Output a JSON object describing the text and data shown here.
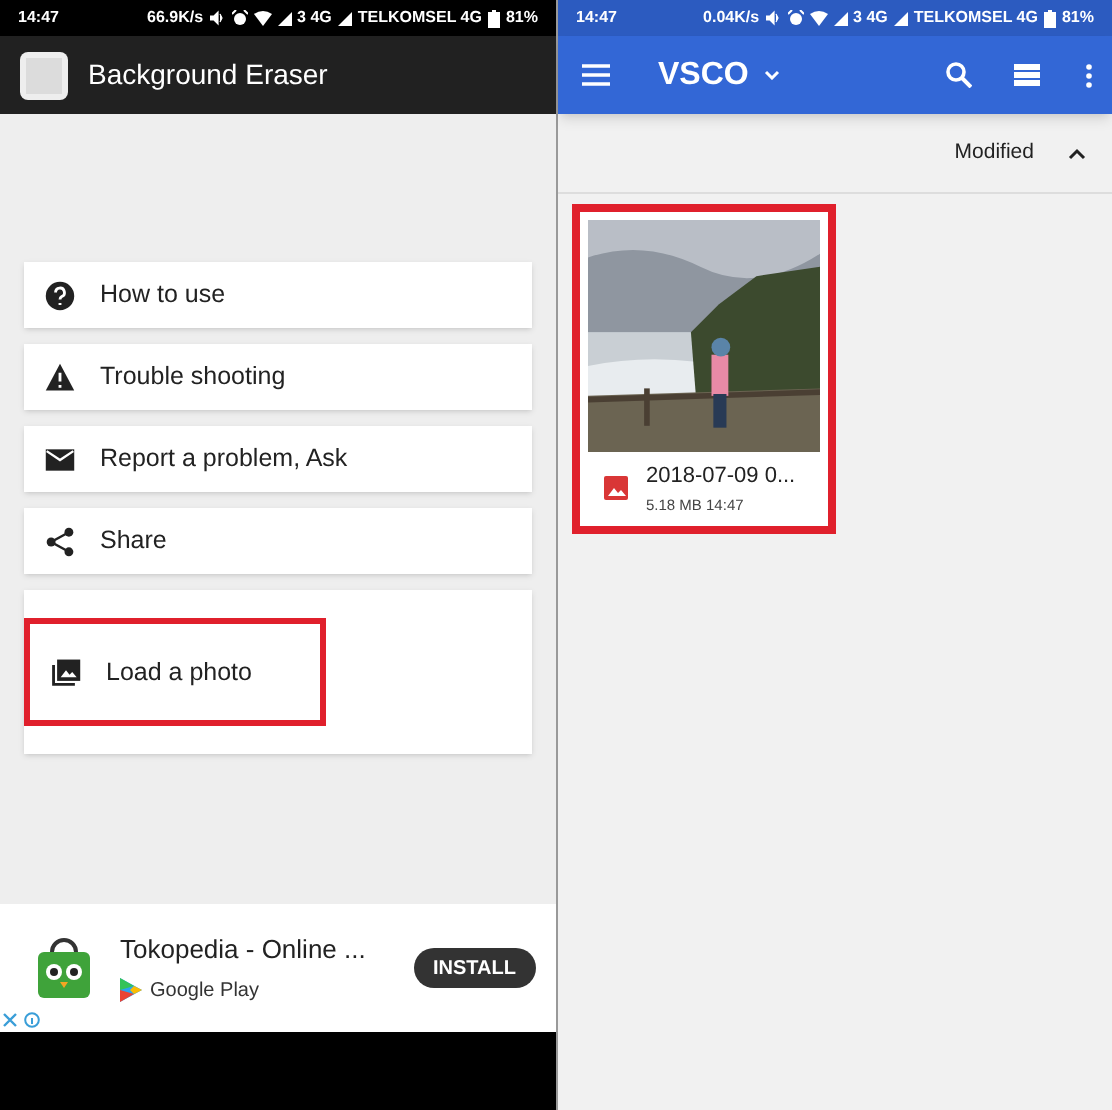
{
  "left_screen": {
    "status_bar": {
      "time": "14:47",
      "speed": "66.9K/s",
      "network_1": "3 4G",
      "carrier": "TELKOMSEL 4G",
      "battery": "81%"
    },
    "app_bar": {
      "title": "Background Eraser"
    },
    "menu": [
      {
        "kind": "help",
        "label": "How to use",
        "highlighted": false
      },
      {
        "kind": "warning",
        "label": "Trouble shooting",
        "highlighted": false
      },
      {
        "kind": "mail",
        "label": "Report a problem, Ask",
        "highlighted": false
      },
      {
        "kind": "share",
        "label": "Share",
        "highlighted": false
      },
      {
        "label": "Load a photo",
        "highlighted": true
      }
    ],
    "ad": {
      "title": "Tokopedia - Online ...",
      "store": "Google Play",
      "button": "INSTALL"
    }
  },
  "right_screen": {
    "status_bar": {
      "time": "14:47",
      "speed": "0.04K/s",
      "network_1": "3 4G",
      "carrier": "TELKOMSEL 4G",
      "battery": "81%"
    },
    "app_bar": {
      "title": "VSCO"
    },
    "sort": {
      "label": "Modified"
    },
    "files": [
      {
        "name": "2018-07-09 0...",
        "details": "5.18 MB 14:47",
        "highlighted": true
      }
    ]
  }
}
